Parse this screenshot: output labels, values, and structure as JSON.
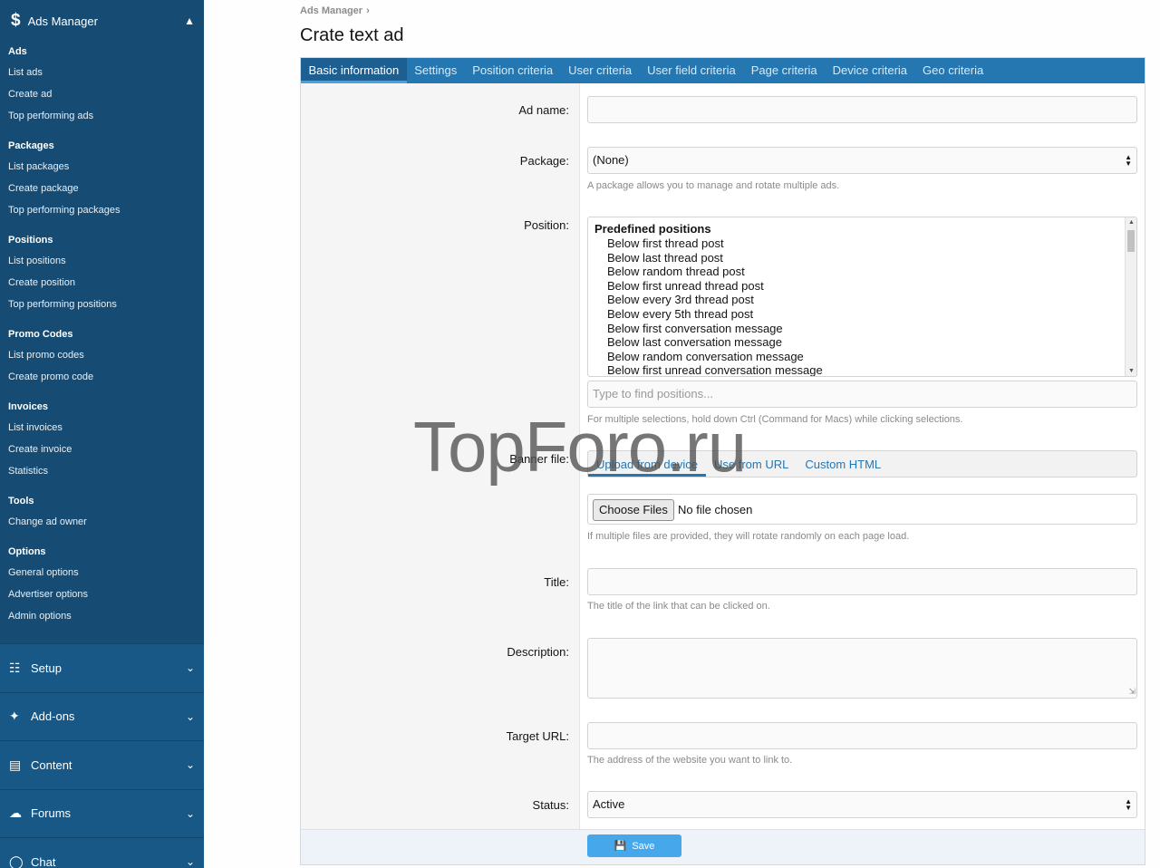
{
  "sidebar": {
    "header": {
      "title": "Ads Manager",
      "icon": "dollar-icon"
    },
    "groups": [
      {
        "title": "Ads",
        "links": [
          "List ads",
          "Create ad",
          "Top performing ads"
        ]
      },
      {
        "title": "Packages",
        "links": [
          "List packages",
          "Create package",
          "Top performing packages"
        ]
      },
      {
        "title": "Positions",
        "links": [
          "List positions",
          "Create position",
          "Top performing positions"
        ]
      },
      {
        "title": "Promo Codes",
        "links": [
          "List promo codes",
          "Create promo code"
        ]
      },
      {
        "title": "Invoices",
        "links": [
          "List invoices",
          "Create invoice",
          "Statistics"
        ]
      },
      {
        "title": "Tools",
        "links": [
          "Change ad owner"
        ]
      },
      {
        "title": "Options",
        "links": [
          "General options",
          "Advertiser options",
          "Admin options"
        ]
      }
    ],
    "sections": [
      {
        "label": "Setup",
        "icon": "sliders-icon"
      },
      {
        "label": "Add-ons",
        "icon": "puzzle-icon"
      },
      {
        "label": "Content",
        "icon": "newspaper-icon"
      },
      {
        "label": "Forums",
        "icon": "comments-icon"
      },
      {
        "label": "Chat",
        "icon": "chat-icon"
      }
    ]
  },
  "breadcrumb": {
    "item": "Ads Manager",
    "separator": "›"
  },
  "page_title": "Crate text ad",
  "tabs": [
    "Basic information",
    "Settings",
    "Position criteria",
    "User criteria",
    "User field criteria",
    "Page criteria",
    "Device criteria",
    "Geo criteria"
  ],
  "form": {
    "ad_name": {
      "label": "Ad name:",
      "value": ""
    },
    "package": {
      "label": "Package:",
      "value": "(None)",
      "hint": "A package allows you to manage and rotate multiple ads."
    },
    "position": {
      "label": "Position:",
      "group": "Predefined positions",
      "options": [
        "Below first thread post",
        "Below last thread post",
        "Below random thread post",
        "Below first unread thread post",
        "Below every 3rd thread post",
        "Below every 5th thread post",
        "Below first conversation message",
        "Below last conversation message",
        "Below random conversation message",
        "Below first unread conversation message"
      ],
      "search_placeholder": "Type to find positions...",
      "hint": "For multiple selections, hold down Ctrl (Command for Macs) while clicking selections."
    },
    "banner": {
      "label": "Banner file:",
      "tabs": [
        "Upload from device",
        "Use from URL",
        "Custom HTML"
      ],
      "choose_button": "Choose Files",
      "file_status": "No file chosen",
      "hint": "If multiple files are provided, they will rotate randomly on each page load."
    },
    "title": {
      "label": "Title:",
      "value": "",
      "hint": "The title of the link that can be clicked on."
    },
    "description": {
      "label": "Description:",
      "value": ""
    },
    "target_url": {
      "label": "Target URL:",
      "value": "",
      "hint": "The address of the website you want to link to."
    },
    "status": {
      "label": "Status:",
      "value": "Active"
    },
    "save_label": "Save"
  },
  "watermark": "TopForo.ru",
  "colors": {
    "sidebar": "#185886",
    "tab_bar": "#2577b1",
    "save_button": "#47a7eb"
  }
}
